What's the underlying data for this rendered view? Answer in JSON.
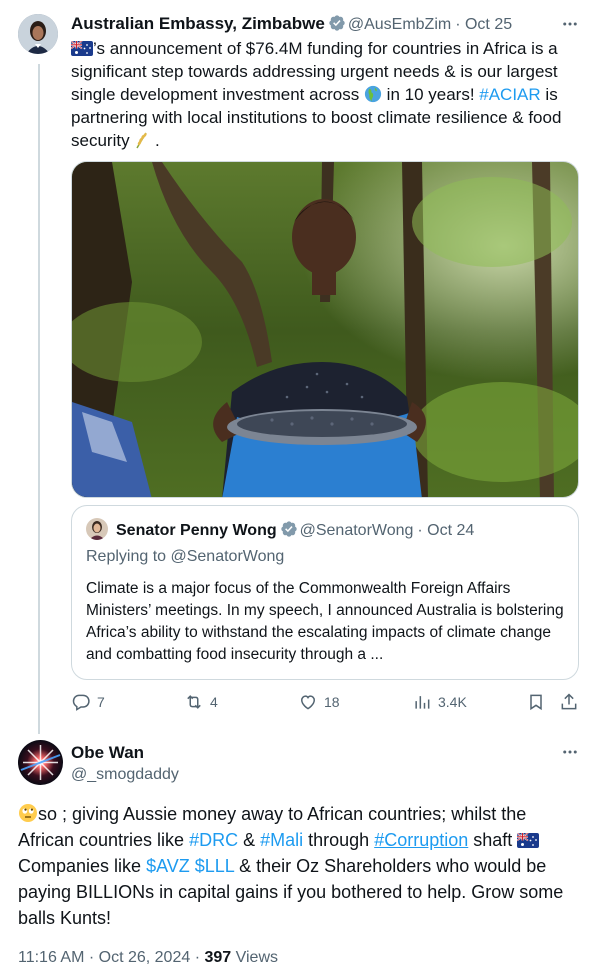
{
  "tweet": {
    "author_name": "Australian Embassy, Zimbabwe",
    "handle": "@AusEmbZim",
    "date": "· Oct 25",
    "text_part1": "’s announcement of $76.4M funding for countries in Africa is a significant step towards addressing urgent needs & is our largest single development investment across ",
    "text_part2": " in 10 years! ",
    "hashtag": "#ACIAR",
    "text_part3": " is partnering with local institutions to boost climate resilience & food security ",
    "text_part4": " .",
    "photo_icon": "photo-woman-winnowing-grain",
    "globe_icon": "globe-africa-emoji",
    "wheat_icon": "rice-ear-emoji"
  },
  "quote": {
    "author_name": "Senator Penny Wong",
    "handle": "@SenatorWong",
    "date": "· Oct 24",
    "replying": "Replying to @SenatorWong",
    "text": "Climate is a major focus of the Commonwealth Foreign Affairs Ministers’ meetings. In my speech, I announced Australia is bolstering Africa’s ability to withstand the escalating impacts of climate change and combatting food insecurity through a ..."
  },
  "actions": {
    "replies": "7",
    "reposts": "4",
    "likes": "18",
    "views": "3.4K"
  },
  "reply": {
    "author_name": "Obe Wan",
    "handle": "@_smogdaddy",
    "text_part1": "so ; giving Aussie money away to African countries; whilst the African countries like ",
    "tag1": "#DRC",
    "text_part2": " & ",
    "tag2": "#Mali",
    "text_part3": " through ",
    "tag3": "#Corruption",
    "text_part4": " shaft ",
    "text_part5": " Companies like ",
    "tag4": "$AVZ",
    "tag5": "$LLL",
    "text_part6": " & their Oz Shareholders who would be paying BILLIONs in capital gains if you bothered to help. Grow some balls Kunts!",
    "time": "11:16 AM · Oct 26, 2024 · ",
    "views_count": "397",
    "views_label": " Views",
    "emoji_icon": "face-with-rolling-eyes-emoji"
  },
  "colors": {
    "link": "#1d9bf0",
    "muted": "#536471",
    "verified": "#829aab",
    "border": "#cfd9de"
  }
}
